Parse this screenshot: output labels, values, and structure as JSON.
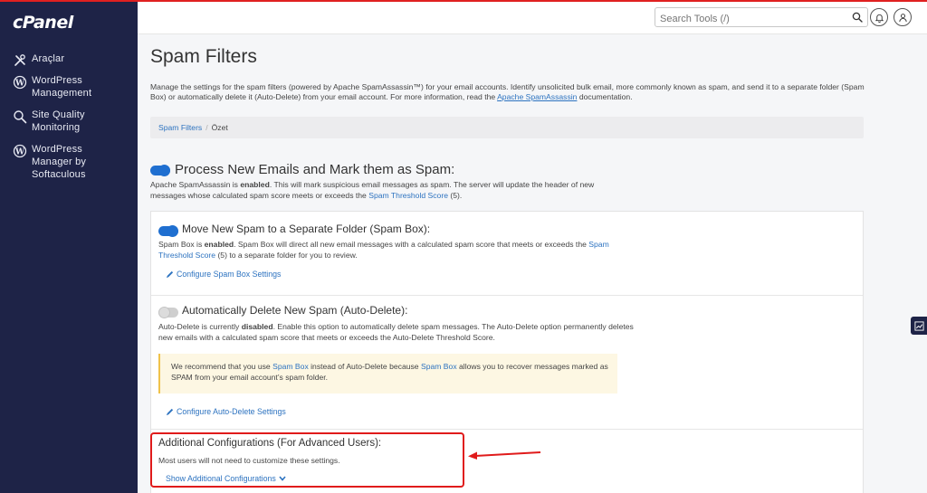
{
  "brand": {
    "logo": "cPanel"
  },
  "sidebar": {
    "items": [
      {
        "label": "Araçlar",
        "icon": "tools-icon"
      },
      {
        "label": "WordPress Management",
        "icon": "wordpress-icon"
      },
      {
        "label": "Site Quality Monitoring",
        "icon": "magnifier-icon"
      },
      {
        "label": "WordPress Manager by Softaculous",
        "icon": "wordpress-icon"
      }
    ]
  },
  "header": {
    "search_placeholder": "Search Tools (/)"
  },
  "page": {
    "title": "Spam Filters",
    "desc_before": "Manage the settings for the spam filters (powered by Apache SpamAssassin™) for your email accounts. Identify unsolicited bulk email, more commonly known as spam, and send it to a separate folder (Spam Box) or automatically delete it (Auto-Delete) from your email account. For more information, read the ",
    "desc_link": "Apache SpamAssassin",
    "desc_after": " documentation."
  },
  "breadcrumb": {
    "root": "Spam Filters",
    "sep": "/",
    "current": "Özet"
  },
  "process": {
    "title": "Process New Emails and Mark them as Spam:",
    "text_1": "Apache SpamAssassin is ",
    "text_bold": "enabled",
    "text_2": ". This will mark suspicious email messages as spam. The server will update the header of new messages whose calculated spam score meets or exceeds the ",
    "link": "Spam Threshold Score",
    "text_3": " (5).",
    "enabled": true
  },
  "spambox": {
    "title": "Move New Spam to a Separate Folder (Spam Box):",
    "text_1": "Spam Box is ",
    "text_bold": "enabled",
    "text_2": ". Spam Box will direct all new email messages with a calculated spam score that meets or exceeds the ",
    "link": "Spam Threshold Score",
    "text_3": " (5) to a separate folder for you to review.",
    "config_link": "Configure Spam Box Settings",
    "enabled": true
  },
  "autodelete": {
    "title": "Automatically Delete New Spam (Auto-Delete):",
    "text_1": "Auto-Delete is currently ",
    "text_bold": "disabled",
    "text_2": ". Enable this option to automatically delete spam messages. The Auto-Delete option permanently deletes new emails with a calculated spam score that meets or exceeds the Auto-Delete Threshold Score.",
    "warn_1": "We recommend that you use ",
    "warn_link_1": "Spam Box",
    "warn_2": " instead of Auto-Delete because ",
    "warn_link_2": "Spam Box",
    "warn_3": " allows you to recover messages marked as SPAM from your email account’s spam folder.",
    "config_link": "Configure Auto-Delete Settings",
    "enabled": false
  },
  "additional": {
    "title": "Additional Configurations (For Advanced Users):",
    "text": "Most users will not need to customize these settings.",
    "show_link": "Show Additional Configurations"
  },
  "colors": {
    "sidebar_bg": "#1e2347",
    "accent": "#1f6fd0",
    "link": "#2d73c0",
    "highlight": "#e01b1b",
    "warning_bg": "#fdf7e3"
  }
}
